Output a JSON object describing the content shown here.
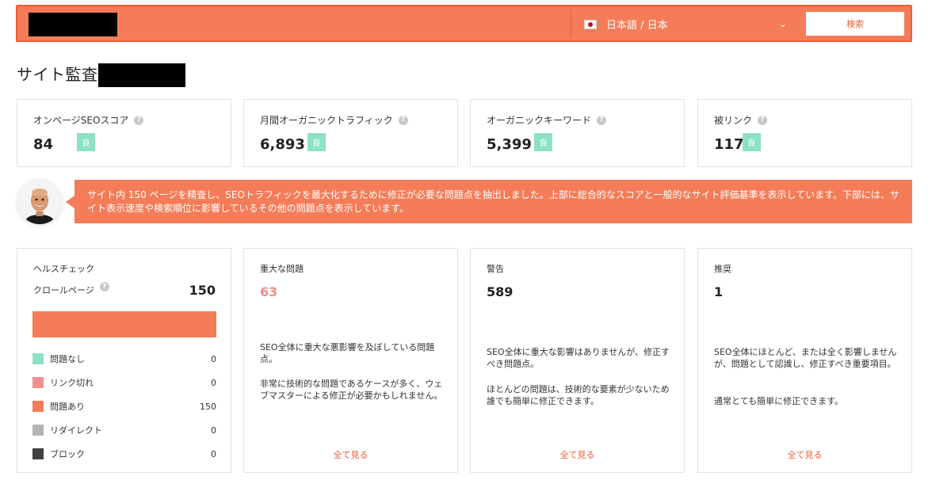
{
  "search": {
    "language_label": "日本語 / 日本",
    "button_label": "検索"
  },
  "page": {
    "title": "サイト監査:"
  },
  "metrics": [
    {
      "label": "オンページSEOスコア",
      "value": "84",
      "badge": "良"
    },
    {
      "label": "月間オーガニックトラフィック",
      "value": "6,893",
      "badge": "良"
    },
    {
      "label": "オーガニックキーワード",
      "value": "5,399",
      "badge": "良"
    },
    {
      "label": "被リンク",
      "value": "117",
      "badge": "良"
    }
  ],
  "banner": {
    "text": "サイト内 150 ページを精査し、SEOトラフィックを最大化するために修正が必要な問題点を抽出しました。上部に総合的なスコアと一般的なサイト評価基準を表示しています。下部には、サイト表示速度や検索順位に影響しているその他の問題点を表示しています。"
  },
  "health": {
    "title": "ヘルスチェック",
    "crawl_label": "クロールページ",
    "crawl_value": "150",
    "bar_fraction_with_issues": 1.0,
    "legend": [
      {
        "label": "問題なし",
        "value": "0",
        "color": "#8de2c6"
      },
      {
        "label": "リンク切れ",
        "value": "0",
        "color": "#f58e8e"
      },
      {
        "label": "問題あり",
        "value": "150",
        "color": "#f47c58"
      },
      {
        "label": "リダイレクト",
        "value": "0",
        "color": "#b3b3b3"
      },
      {
        "label": "ブロック",
        "value": "0",
        "color": "#404040"
      }
    ]
  },
  "issues": [
    {
      "title": "重大な問題",
      "value": "63",
      "desc1": "SEO全体に重大な悪影響を及ぼしている問題点。",
      "desc2": "非常に技術的な問題であるケースが多く、ウェブマスターによる修正が必要かもしれません。",
      "link": "全て見る"
    },
    {
      "title": "警告",
      "value": "589",
      "desc1": "SEO全体に重大な影響はありませんが、修正すべき問題点。",
      "desc2": "ほとんどの問題は、技術的な要素が少ないため誰でも簡単に修正できます。",
      "link": "全て見る"
    },
    {
      "title": "推奨",
      "value": "1",
      "desc1": "SEO全体にほとんど、または全く影響しませんが、問題として認識し、修正すべき重要項目。",
      "desc2": "通常とても簡単に修正できます。",
      "link": "全て見る"
    }
  ],
  "colors": {
    "accent": "#f47c58",
    "good_badge": "#8de2c6",
    "critical_value": "#f08c8c"
  }
}
